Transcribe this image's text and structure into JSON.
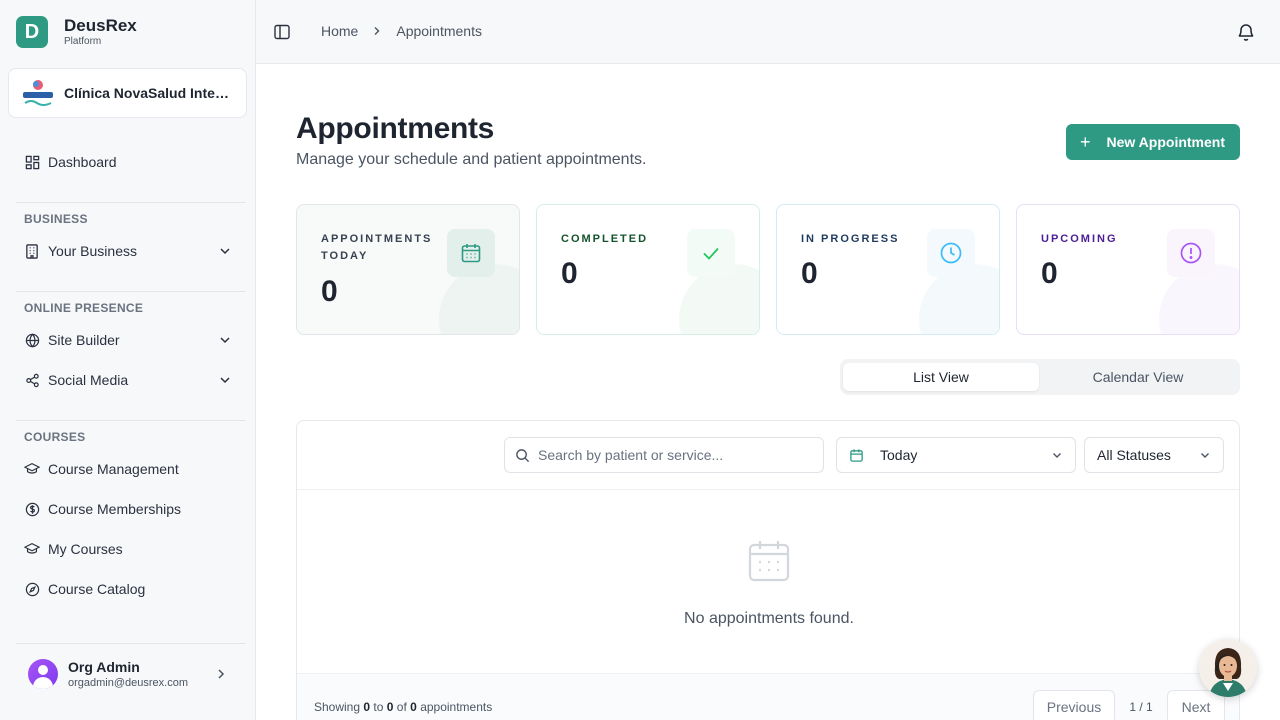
{
  "brand": {
    "logo_letter": "D",
    "name": "DeusRex",
    "subtitle": "Platform"
  },
  "org": {
    "name": "Clínica NovaSalud Integ…"
  },
  "nav": {
    "dashboard": "Dashboard",
    "sections": {
      "business": "BUSINESS",
      "online_presence": "ONLINE PRESENCE",
      "courses": "COURSES"
    },
    "your_business": "Your Business",
    "site_builder": "Site Builder",
    "social_media": "Social Media",
    "course_management": "Course Management",
    "course_memberships": "Course Memberships",
    "my_courses": "My Courses",
    "course_catalog": "Course Catalog"
  },
  "user": {
    "name": "Org Admin",
    "email": "orgadmin@deusrex.com"
  },
  "breadcrumb": {
    "home": "Home",
    "current": "Appointments"
  },
  "page": {
    "title": "Appointments",
    "subtitle": "Manage your schedule and patient appointments.",
    "new_button": "New Appointment"
  },
  "stats": [
    {
      "label": "APPOINTMENTS TODAY",
      "value": "0",
      "color": "#2e9a84"
    },
    {
      "label": "COMPLETED",
      "value": "0",
      "color": "#22c55e"
    },
    {
      "label": "IN PROGRESS",
      "value": "0",
      "color": "#38bdf8"
    },
    {
      "label": "UPCOMING",
      "value": "0",
      "color": "#a855f7"
    }
  ],
  "views": {
    "list": "List View",
    "calendar": "Calendar View"
  },
  "filters": {
    "search_placeholder": "Search by patient or service...",
    "date": "Today",
    "status": "All Statuses"
  },
  "empty": {
    "text": "No appointments found."
  },
  "footer": {
    "showing": "Showing",
    "from": "0",
    "to_word": "to",
    "to": "0",
    "of_word": "of",
    "total": "0",
    "suffix": "appointments",
    "previous": "Previous",
    "page_info": "1 / 1",
    "next": "Next"
  },
  "colors": {
    "accent": "#2e9a84",
    "text": "#1f2530",
    "muted": "#4b5563"
  }
}
